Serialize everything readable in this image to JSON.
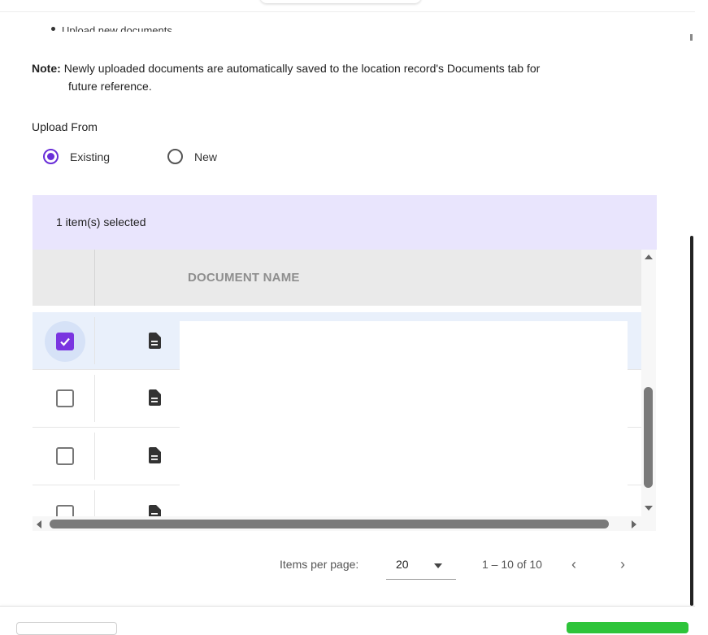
{
  "intro": {
    "bullet_text": "Upload new documents",
    "note_label": "Note:",
    "note_text_line1": "Newly uploaded documents are automatically saved to the location record's Documents tab for",
    "note_text_line2": "future reference."
  },
  "upload_from": {
    "label": "Upload From",
    "options": [
      {
        "label": "Existing",
        "selected": true
      },
      {
        "label": "New",
        "selected": false
      }
    ]
  },
  "selection_bar": {
    "text": "1 item(s) selected"
  },
  "table": {
    "column_header": "DOCUMENT NAME",
    "rows": [
      {
        "checked": true
      },
      {
        "checked": false
      },
      {
        "checked": false
      },
      {
        "checked": false
      }
    ]
  },
  "pagination": {
    "items_per_page_label": "Items per page:",
    "page_size": "20",
    "range_text": "1 – 10 of 10",
    "prev_icon": "‹",
    "next_icon": "›"
  },
  "colors": {
    "accent": "#6a2fd8",
    "selection_bar_bg": "#e9e5fd",
    "selected_row_bg": "#e9f0fb",
    "primary_button": "#2ec43a"
  }
}
